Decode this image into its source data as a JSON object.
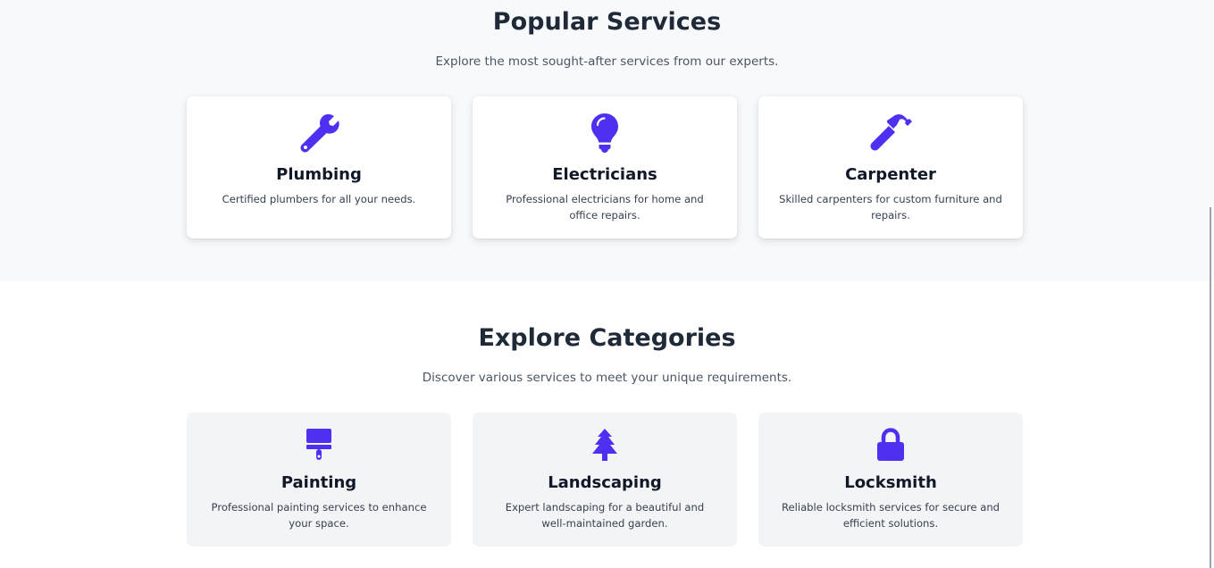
{
  "popular_services": {
    "title": "Popular Services",
    "subtitle": "Explore the most sought-after services from our experts.",
    "cards": [
      {
        "title": "Plumbing",
        "description": "Certified plumbers for all your needs.",
        "icon": "wrench-icon"
      },
      {
        "title": "Electricians",
        "description": "Professional electricians for home and office repairs.",
        "icon": "lightbulb-icon"
      },
      {
        "title": "Carpenter",
        "description": "Skilled carpenters for custom furniture and repairs.",
        "icon": "hammer-icon"
      }
    ]
  },
  "explore_categories": {
    "title": "Explore Categories",
    "subtitle": "Discover various services to meet your unique requirements.",
    "cards": [
      {
        "title": "Painting",
        "description": "Professional painting services to enhance your space.",
        "icon": "paint-roller-icon"
      },
      {
        "title": "Landscaping",
        "description": "Expert landscaping for a beautiful and well-maintained garden.",
        "icon": "tree-icon"
      },
      {
        "title": "Locksmith",
        "description": "Reliable locksmith services for secure and efficient solutions.",
        "icon": "lock-icon"
      }
    ]
  },
  "colors": {
    "accent": "#4f2ff0",
    "heading": "#1f2937",
    "section_bg": "#f8f9fb",
    "category_card_bg": "#f3f4f6"
  }
}
